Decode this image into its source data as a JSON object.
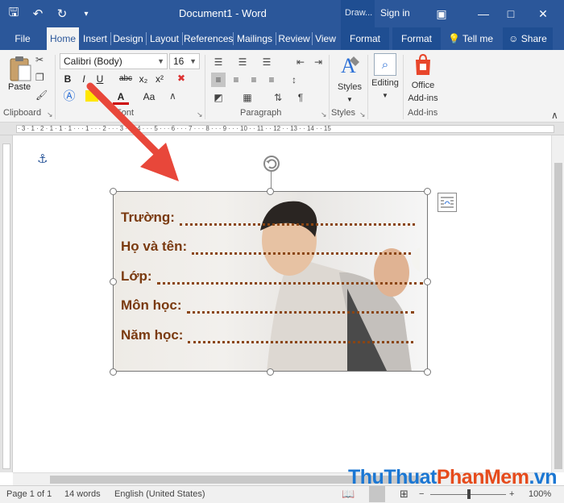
{
  "window": {
    "title": "Document1  -  Word",
    "context_tab_group": "Draw...",
    "sign_in": "Sign in"
  },
  "tabs": {
    "file": "File",
    "home": "Home",
    "insert": "Insert",
    "design": "Design",
    "layout": "Layout",
    "references": "References",
    "mailings": "Mailings",
    "review": "Review",
    "view": "View",
    "format1": "Format",
    "format2": "Format",
    "tell_me": "Tell me",
    "share": "Share"
  },
  "ribbon": {
    "clipboard": {
      "paste": "Paste",
      "group": "Clipboard"
    },
    "font": {
      "name": "Calibri (Body)",
      "size": "16",
      "bold": "B",
      "italic": "I",
      "underline": "U",
      "strike": "abc",
      "subscript": "x₂",
      "superscript": "x²",
      "case": "Aa",
      "text_color": "A",
      "group": "Font"
    },
    "paragraph": {
      "group": "Paragraph",
      "pilcrow": "¶"
    },
    "styles": {
      "label": "Styles",
      "group": "Styles"
    },
    "editing": {
      "label": "Editing"
    },
    "addins": {
      "label1": "Office",
      "label2": "Add-ins",
      "group": "Add-ins"
    }
  },
  "ruler": {
    "marks": "· 3 · 1 · 2 · 1 · 1 · 1 · · · 1 · · · 2 · · · 3 · · · 4 · · · 5 · · · 6 · · · 7 · · · 8 · · · 9 · · · 10 · · 11 · · 12 · · 13 · · 14 · · 15"
  },
  "form": {
    "rows": [
      "Trường:",
      "Họ và tên:",
      "Lớp:",
      "Môn học:",
      "Năm học:"
    ]
  },
  "status": {
    "page": "Page 1 of 1",
    "words": "14 words",
    "language": "English (United States)",
    "zoom": "100%"
  },
  "watermark": {
    "part1": "ThuThuat",
    "part2": "PhanMem",
    "part3": ".vn"
  },
  "colors": {
    "brand": "#2b579a",
    "arrow": "#e8473a",
    "form_text": "#7a3a10"
  }
}
